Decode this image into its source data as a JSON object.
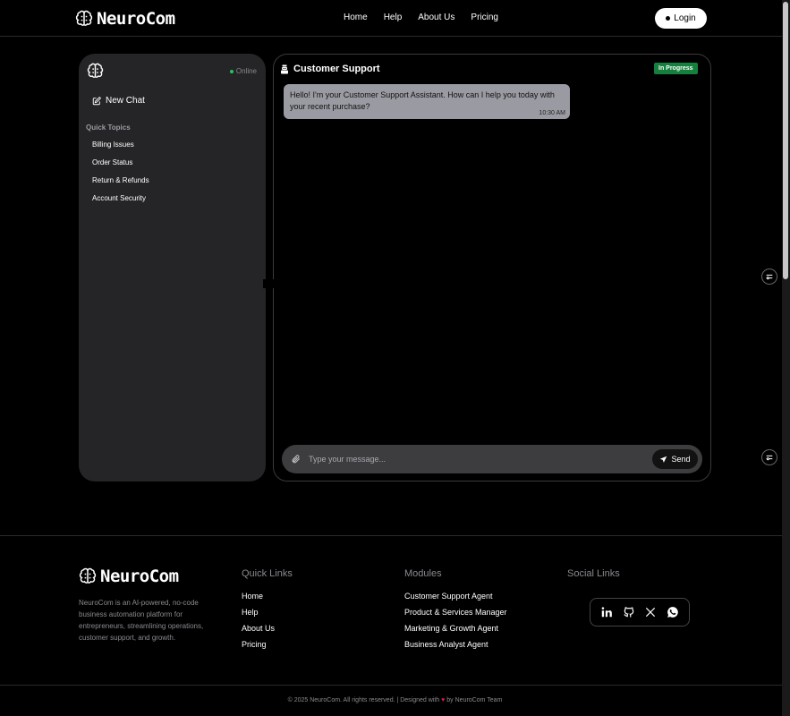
{
  "brand": {
    "name": "NeuroCom"
  },
  "nav": {
    "items": [
      "Home",
      "Help",
      "About Us",
      "Pricing"
    ],
    "login_label": "Login"
  },
  "sidebar": {
    "status": "Online",
    "new_chat_label": "New Chat",
    "quick_topics_title": "Quick Topics",
    "topics": [
      "Billing Issues",
      "Order Status",
      "Return & Refunds",
      "Account Security"
    ]
  },
  "chat": {
    "title": "Customer Support",
    "status_badge": "In Progress",
    "messages": [
      {
        "text": "Hello! I'm your Customer Support Assistant. How can I help you today with your recent purchase?",
        "time": "10:30 AM"
      }
    ],
    "input_placeholder": "Type your message...",
    "send_label": "Send"
  },
  "footer": {
    "brand": "NeuroCom",
    "description": "NeuroCom is an AI-powered, no-code business automation platform for entrepreneurs, streamlining operations, customer support, and growth.",
    "quick_links_title": "Quick Links",
    "quick_links": [
      "Home",
      "Help",
      "About Us",
      "Pricing"
    ],
    "modules_title": "Modules",
    "modules": [
      "Customer Support Agent",
      "Product & Services Manager",
      "Marketing & Growth Agent",
      "Business Analyst Agent"
    ],
    "social_title": "Social Links",
    "socials": [
      "linkedin-icon",
      "github-icon",
      "x-icon",
      "whatsapp-icon"
    ],
    "copyright_pre": "© 2025 NeuroCom. All rights reserved. | Designed with",
    "copyright_post": "by NeuroCom Team"
  },
  "colors": {
    "status_green": "#15803d",
    "online_dot": "#22c55e",
    "heart": "#e11d48",
    "sidebar_bg": "#252527",
    "bubble_bg": "#9a9aa2"
  }
}
